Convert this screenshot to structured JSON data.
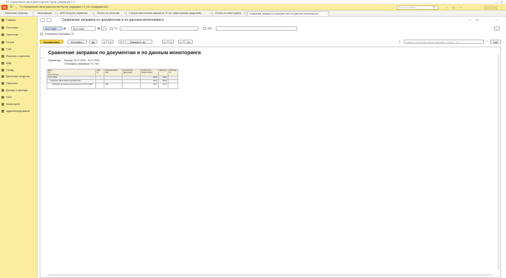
{
  "window": {
    "title": "ТС:Управление автотранспортом Проф, редакция 2.2"
  },
  "app_bar": {
    "title": "ТС:Управление автотранспортом Проф, редакция 2.2   (1С:Предприятие)",
    "search_placeholder": "Поиск Ctrl+Shift+F"
  },
  "tabs": [
    {
      "label": "Начальная страница"
    },
    {
      "label": "Информация"
    },
    {
      "label": "АРМ Контроль перевозок"
    },
    {
      "label": "Отчеты по логистике"
    },
    {
      "label": "Статусы выполнения заказов на ТС (по транспортным средствам)"
    },
    {
      "label": "Отчеты по мониторингу"
    },
    {
      "label": "Сравнение заправок по документам и по данным мониторинга"
    }
  ],
  "sidebar": {
    "items": [
      {
        "label": "Главное"
      },
      {
        "label": "Логистика"
      },
      {
        "label": "Транспорт"
      },
      {
        "label": "Услуги"
      },
      {
        "label": "ГСМ"
      },
      {
        "label": "Ремонты и агрегаты"
      },
      {
        "label": "БДД"
      },
      {
        "label": "Склад"
      },
      {
        "label": "Денежные средства"
      },
      {
        "label": "Персонал"
      },
      {
        "label": "Доходы и расходы"
      },
      {
        "label": "НСИ"
      },
      {
        "label": "Мониторинг"
      },
      {
        "label": "Администрирование"
      }
    ]
  },
  "form": {
    "title": "Сравнение заправок по документам и по данным мониторинга",
    "date_from": "01.07.2025",
    "date_to": "31.07.2025",
    "period_btn": "...",
    "ts_label": "ТС:",
    "azs_label": "АЗС:",
    "show_retired_label": "Отображать выбывшие ТС",
    "generate_btn": "Сформировать",
    "settings_btn": "Настройки...",
    "expand_btn": "Развернуть до...",
    "search_placeholder": "Введите строку для поиска (например, строку, 2 сл...",
    "more_btn": "Еще"
  },
  "report": {
    "title": "Сравнение заправок по документам и по данным мониторинга",
    "params_label": "Параметры:",
    "params_period": "Период: 01.07.2025 - 31.07.2025",
    "params_retired": "Отображать выбывшие ТС: Нет",
    "headers": {
      "date": "Дата",
      "ts": "ТС",
      "registrar": "Регистратор",
      "azs_short": "АЗС",
      "azs_pct": "%",
      "azs_name": "Наименование АЗС",
      "qty_doc": "Количество (Документ)",
      "qty_mon": "Количество (Мониторинг)",
      "diff": "Разница",
      "diff_pct": "Разница, %"
    },
    "rows": [
      {
        "name": "01.07.2025",
        "azs": "",
        "qty_doc": "",
        "qty_mon": "110,0",
        "diff": "110,0"
      },
      {
        "name": "Самосвал МКМ 2115FS М435СН750",
        "azs": "",
        "qty_doc": "",
        "qty_mon": "110,0",
        "diff": "110,0"
      },
      {
        "name": "Заправка по данным мониторинга от 01.07.2025",
        "azs": "АЗС",
        "qty_doc": "",
        "qty_mon": "110,0",
        "diff": "110,0"
      }
    ]
  }
}
